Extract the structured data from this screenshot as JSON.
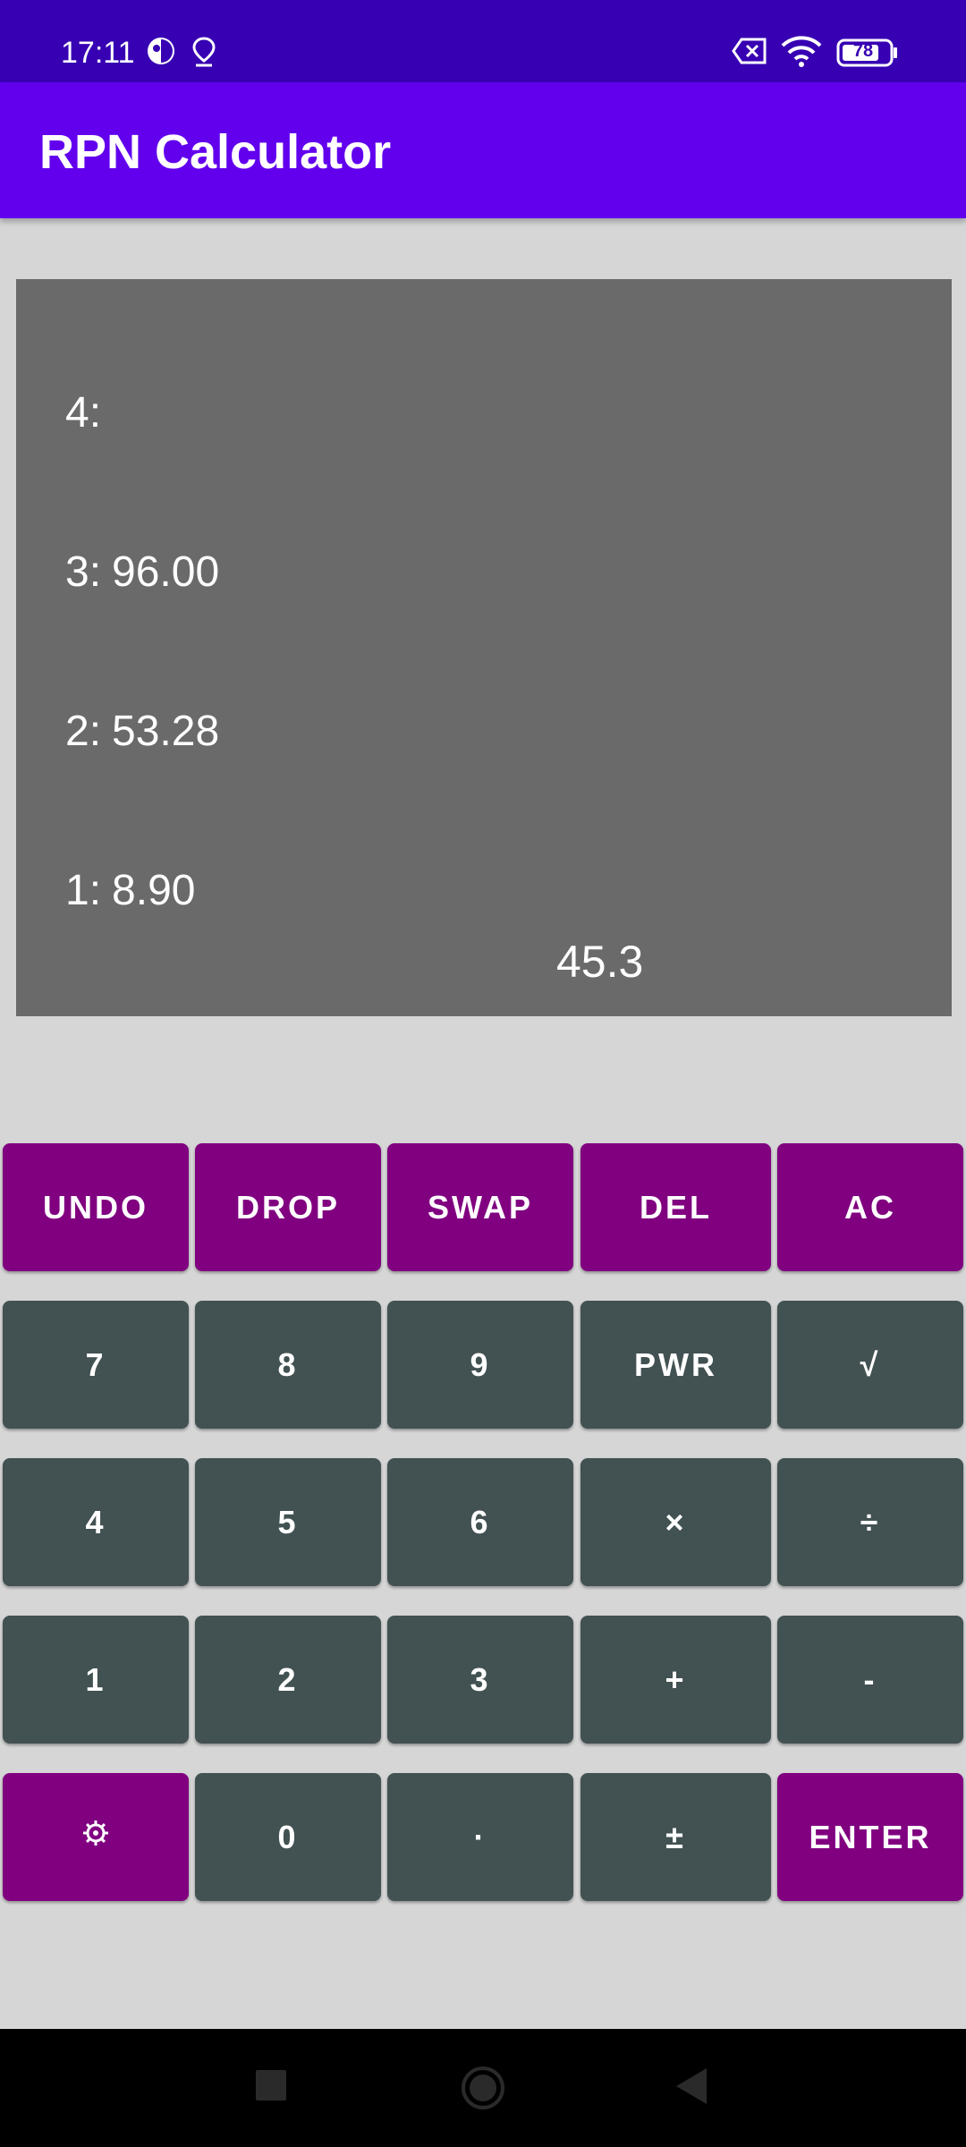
{
  "status_bar": {
    "time": "17:11",
    "battery": "78",
    "icons": [
      "app-notification-icon",
      "location-pin-icon",
      "no-sim-icon",
      "wifi-icon",
      "battery-icon"
    ]
  },
  "app_bar": {
    "title": "RPN Calculator"
  },
  "display": {
    "stack": [
      {
        "label": "4:",
        "value": ""
      },
      {
        "label": "3:",
        "value": "96.00"
      },
      {
        "label": "2:",
        "value": "53.28"
      },
      {
        "label": "1:",
        "value": "8.90"
      }
    ],
    "entry": "45.3"
  },
  "keypad": {
    "rows": [
      [
        {
          "label": "UNDO",
          "name": "undo-button",
          "style": "purple"
        },
        {
          "label": "DROP",
          "name": "drop-button",
          "style": "purple"
        },
        {
          "label": "SWAP",
          "name": "swap-button",
          "style": "purple"
        },
        {
          "label": "DEL",
          "name": "delete-button",
          "style": "purple"
        },
        {
          "label": "AC",
          "name": "all-clear-button",
          "style": "purple"
        }
      ],
      [
        {
          "label": "7",
          "name": "digit-7-button",
          "style": "slate"
        },
        {
          "label": "8",
          "name": "digit-8-button",
          "style": "slate"
        },
        {
          "label": "9",
          "name": "digit-9-button",
          "style": "slate"
        },
        {
          "label": "PWR",
          "name": "power-button",
          "style": "slate"
        },
        {
          "label": "√",
          "name": "square-root-button",
          "style": "slate"
        }
      ],
      [
        {
          "label": "4",
          "name": "digit-4-button",
          "style": "slate"
        },
        {
          "label": "5",
          "name": "digit-5-button",
          "style": "slate"
        },
        {
          "label": "6",
          "name": "digit-6-button",
          "style": "slate"
        },
        {
          "label": "×",
          "name": "multiply-button",
          "style": "slate"
        },
        {
          "label": "÷",
          "name": "divide-button",
          "style": "slate"
        }
      ],
      [
        {
          "label": "1",
          "name": "digit-1-button",
          "style": "slate"
        },
        {
          "label": "2",
          "name": "digit-2-button",
          "style": "slate"
        },
        {
          "label": "3",
          "name": "digit-3-button",
          "style": "slate"
        },
        {
          "label": "+",
          "name": "add-button",
          "style": "slate"
        },
        {
          "label": "-",
          "name": "subtract-button",
          "style": "slate"
        }
      ],
      [
        {
          "label": "",
          "name": "settings-button",
          "style": "purple",
          "icon": "gear-icon"
        },
        {
          "label": "0",
          "name": "digit-0-button",
          "style": "slate"
        },
        {
          "label": "·",
          "name": "decimal-point-button",
          "style": "slate"
        },
        {
          "label": "±",
          "name": "plus-minus-button",
          "style": "slate"
        },
        {
          "label": "ENTER",
          "name": "enter-button",
          "style": "purple"
        }
      ]
    ]
  },
  "colors": {
    "status_bar": "#3700b3",
    "app_bar": "#6200ee",
    "background": "#d6d6d6",
    "display": "#6a6a6a",
    "key_purple": "#800080",
    "key_slate": "#425152",
    "nav_bar": "#000000"
  },
  "nav_bar": {
    "buttons": [
      "recents-square-icon",
      "home-circle-icon",
      "back-triangle-icon"
    ]
  }
}
